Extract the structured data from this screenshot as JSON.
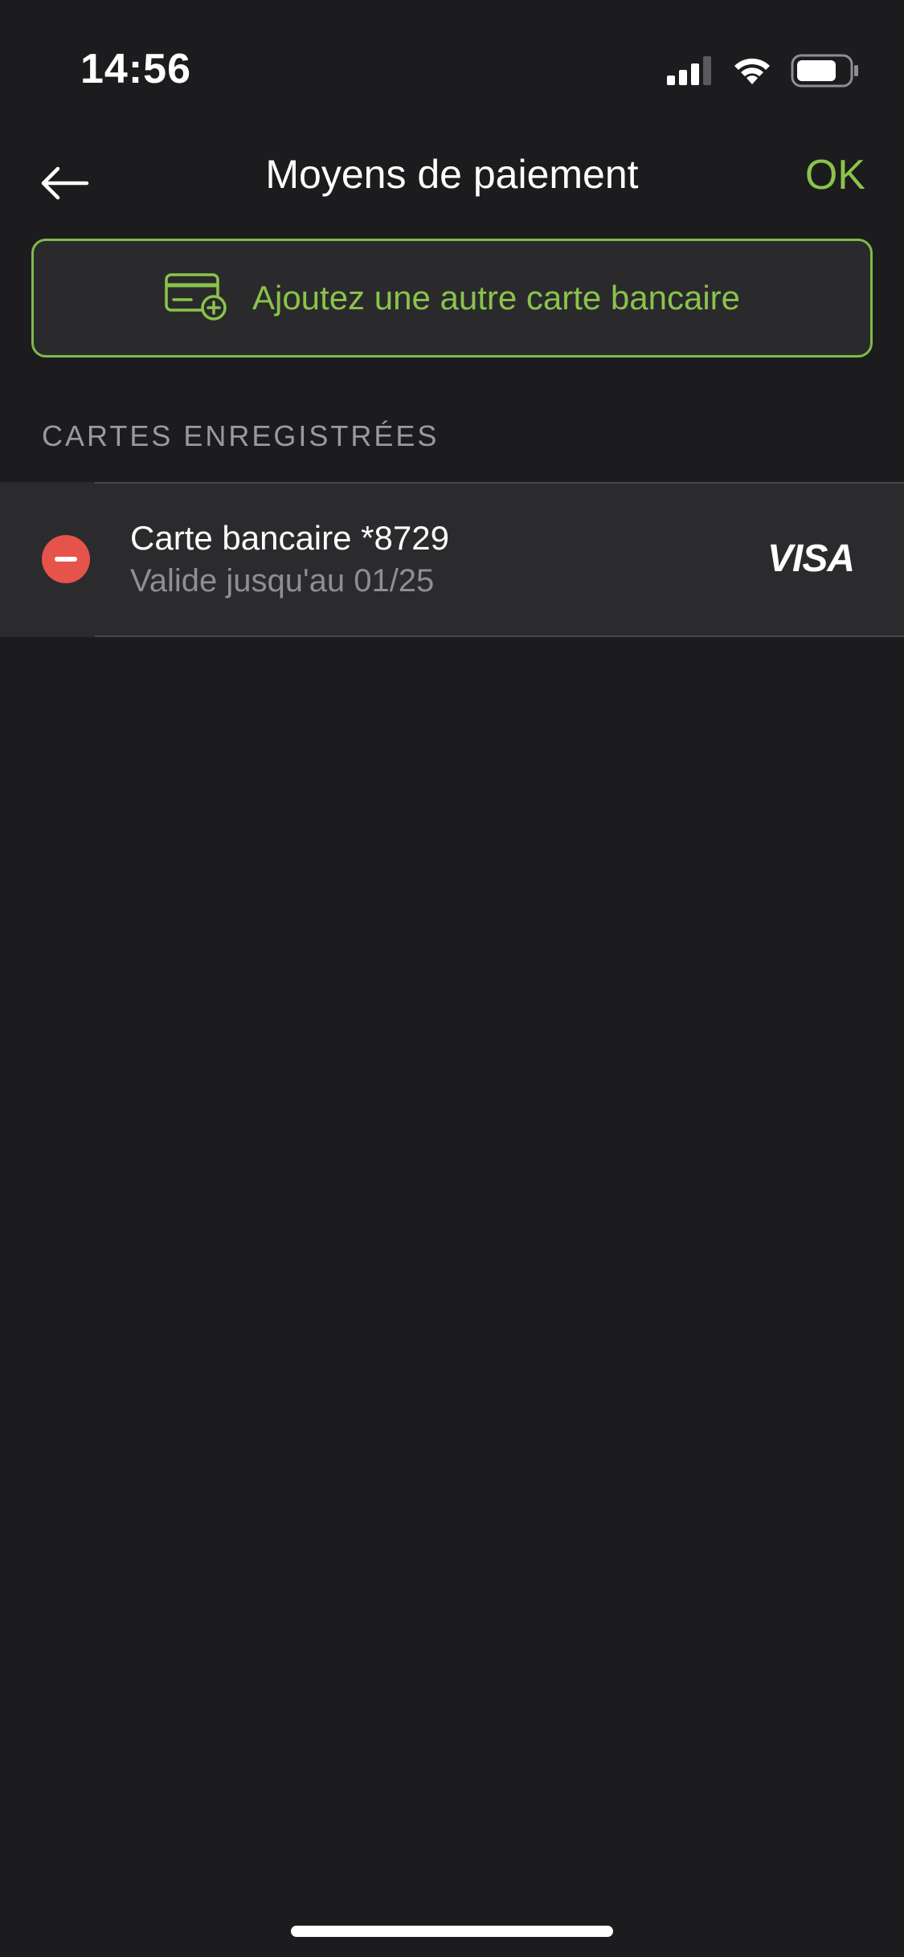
{
  "status_bar": {
    "time": "14:56",
    "icons": [
      "cellular-signal-icon",
      "wifi-icon",
      "battery-icon"
    ]
  },
  "nav": {
    "back_icon": "arrow-left-icon",
    "title": "Moyens de paiement",
    "ok_label": "OK"
  },
  "add_card": {
    "icon": "credit-card-add-icon",
    "label": "Ajoutez une autre carte bancaire"
  },
  "saved_cards": {
    "header": "CARTES ENREGISTRÉES",
    "items": [
      {
        "title": "Carte bancaire *8729",
        "expiry": "Valide jusqu'au 01/25",
        "brand": "VISA",
        "delete_icon": "minus-circle-icon"
      }
    ]
  },
  "colors": {
    "background": "#1c1c1e",
    "accent": "#8bc34a",
    "row_background": "#2b2b2e",
    "danger": "#e5534b",
    "secondary_text": "#8e8e93"
  }
}
